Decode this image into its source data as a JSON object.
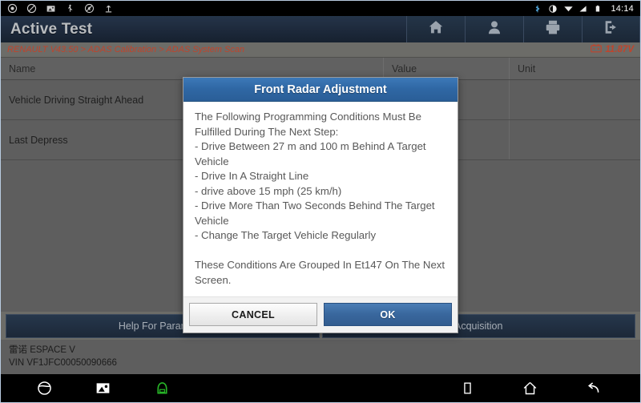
{
  "statusbar": {
    "left_icons": [
      "record-icon",
      "no-entry-icon",
      "screenshot-icon",
      "usb-icon",
      "mute-icon",
      "upload-icon"
    ],
    "right_icons": [
      "bluetooth-icon",
      "brightness-icon",
      "wifi-icon",
      "signal-icon",
      "battery-icon"
    ],
    "time": "14:14"
  },
  "header": {
    "title": "Active Test",
    "toolbar": [
      {
        "name": "home-button",
        "icon": "home-icon"
      },
      {
        "name": "user-button",
        "icon": "user-icon"
      },
      {
        "name": "print-button",
        "icon": "printer-icon"
      },
      {
        "name": "exit-button",
        "icon": "exit-icon"
      }
    ]
  },
  "breadcrumb": {
    "path": "RENAULT V43.50 > ADAS Calibration > ADAS System Scan",
    "battery_icon": "battery-voltage-icon",
    "voltage": "11.87V",
    "accent_color": "#c0442c"
  },
  "table": {
    "columns": [
      "Name",
      "Value",
      "Unit"
    ],
    "rows": [
      {
        "name": "Vehicle Driving Straight Ahead",
        "value": "",
        "unit": ""
      },
      {
        "name": "Last Depress",
        "value": "",
        "unit": ""
      }
    ]
  },
  "dialog": {
    "title": "Front Radar Adjustment",
    "message": "The Following Programming Conditions Must Be Fulfilled During The Next Step:\n- Drive Between 27 m and 100 m Behind A Target Vehicle\n- Drive In A Straight Line\n- drive above 15 mph (25 km/h)\n- Drive More Than Two Seconds Behind The Target Vehicle\n- Change The Target Vehicle Regularly\n\nThese Conditions Are Grouped In Et147 On The Next Screen.",
    "cancel_label": "CANCEL",
    "ok_label": "OK",
    "header_color": "#2f67a4",
    "ok_color": "#39679d"
  },
  "actions": {
    "help": "Help For Parameter",
    "acquisition": "Acquisition"
  },
  "vehicle": {
    "model": "雷诺 ESPACE V",
    "vin": "VIN VF1JFC00050090666"
  },
  "navbar": {
    "left_icons": [
      "browser-icon",
      "gallery-icon",
      "vci-connector-icon"
    ],
    "right_icons": [
      "recents-icon",
      "home-icon",
      "back-icon"
    ],
    "vci_color": "#27b427"
  }
}
